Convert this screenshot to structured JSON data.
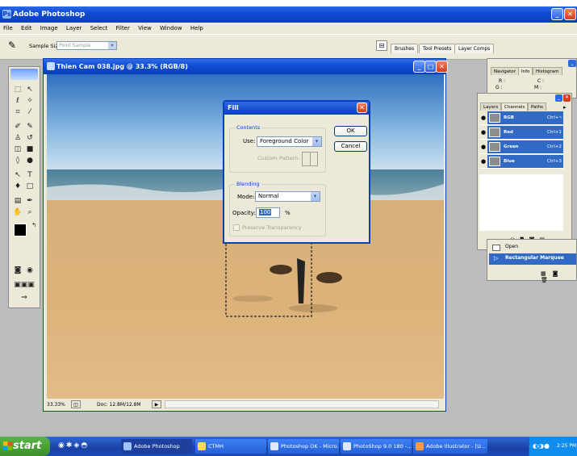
{
  "app": {
    "title": "Adobe Photoshop"
  },
  "menu": [
    "File",
    "Edit",
    "Image",
    "Layer",
    "Select",
    "Filter",
    "View",
    "Window",
    "Help"
  ],
  "options": {
    "sample_size_label": "Sample Size:",
    "sample_size_value": "Point Sample"
  },
  "palette_well": [
    "Brushes",
    "Tool Presets",
    "Layer Comps"
  ],
  "document": {
    "title": "Thien Cam 038.jpg @ 33.3% (RGB/8)",
    "zoom": "33.33%",
    "doc_size": "Doc: 12.8M/12.8M"
  },
  "fill_dialog": {
    "title": "Fill",
    "contents_label": "Contents",
    "use_label": "Use:",
    "use_value": "Foreground Color",
    "custom_pattern_label": "Custom Pattern:",
    "blending_label": "Blending",
    "mode_label": "Mode:",
    "mode_value": "Normal",
    "opacity_label": "Opacity:",
    "opacity_value": "100",
    "opacity_unit": "%",
    "preserve_label": "Preserve Transparency",
    "ok": "OK",
    "cancel": "Cancel"
  },
  "info_palette": {
    "tabs": [
      "Navigator",
      "Info",
      "Histogram"
    ],
    "r": "R :",
    "c": "C :",
    "g": "G :",
    "m": "M :"
  },
  "layers_palette": {
    "tabs": [
      "Layers",
      "Channels",
      "Paths"
    ],
    "channels": [
      {
        "name": "RGB",
        "shortcut": "Ctrl+~"
      },
      {
        "name": "Red",
        "shortcut": "Ctrl+1"
      },
      {
        "name": "Green",
        "shortcut": "Ctrl+2"
      },
      {
        "name": "Blue",
        "shortcut": "Ctrl+3"
      }
    ]
  },
  "history": {
    "items": [
      "Open",
      "Rectangular Marquee"
    ]
  },
  "taskbar": {
    "start": "start",
    "buttons": [
      "Adobe Photoshop",
      "CTMH",
      "Photoshop OK - Micro...",
      "PhotoShop 9.0 180 -...",
      "Adobe Illustrator - [U..."
    ],
    "time": "2:25 PM"
  }
}
